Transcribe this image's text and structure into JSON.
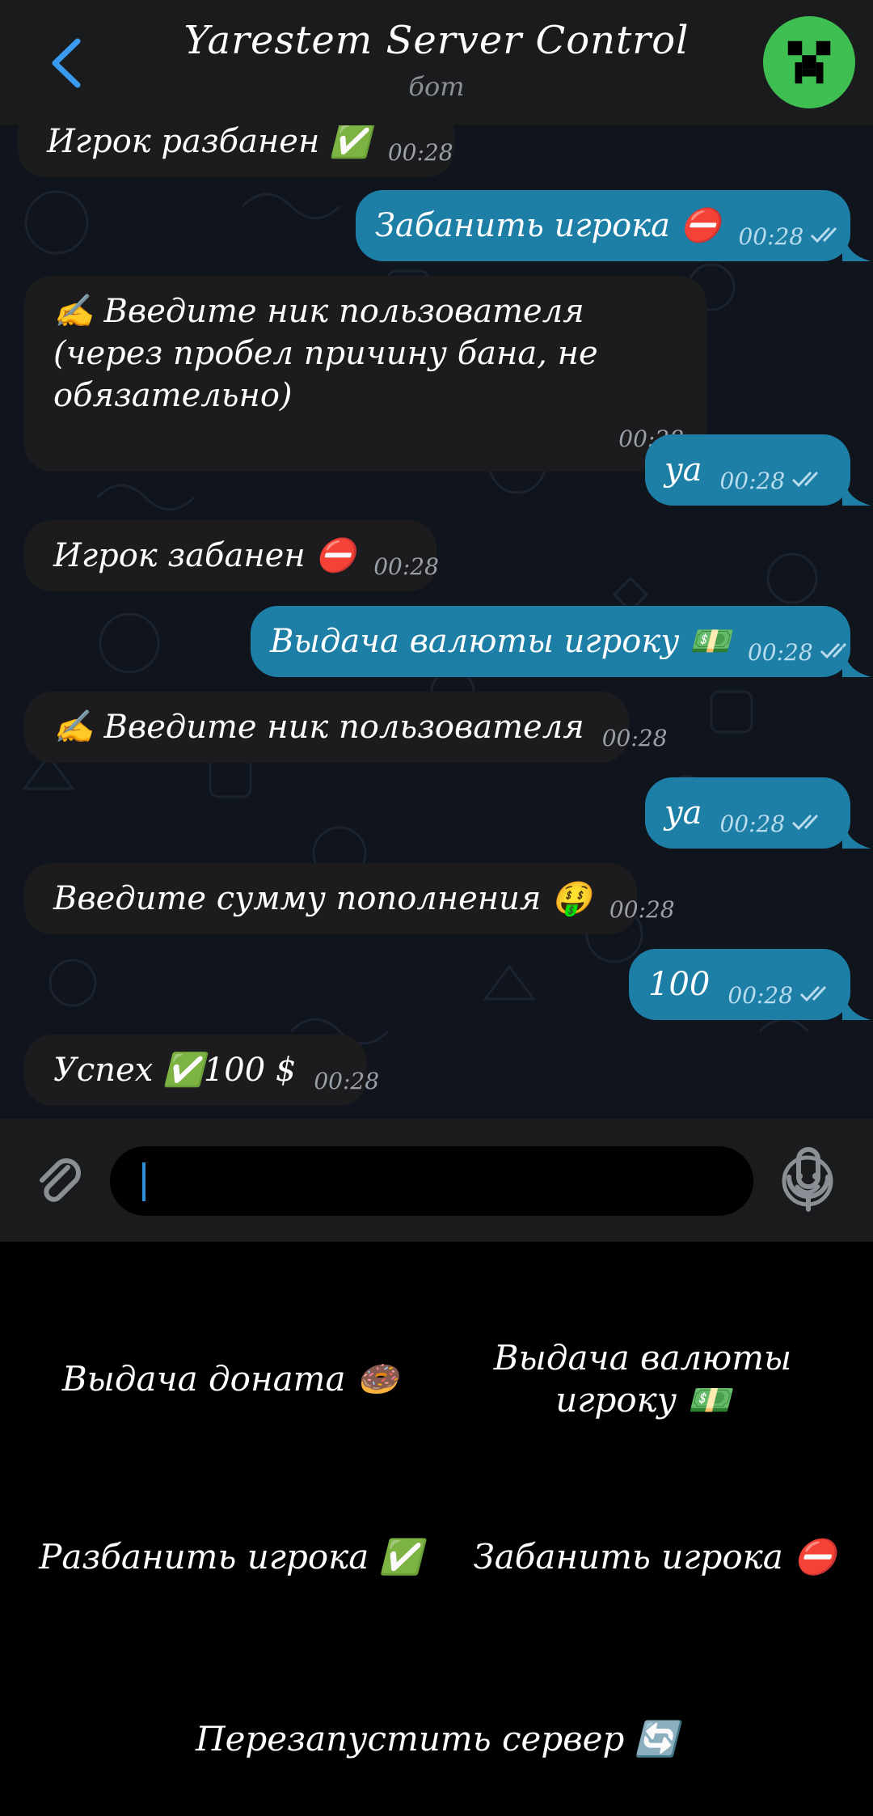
{
  "header": {
    "title": "Yarestem Server Control",
    "subtitle": "бот"
  },
  "messages": [
    {
      "dir": "in",
      "text": "Игрок разбанен ✅",
      "time": "00:28"
    },
    {
      "dir": "out",
      "text": "Забанить игрока ⛔",
      "time": "00:28"
    },
    {
      "dir": "in",
      "text": "✍️ Введите ник пользователя (через пробел причину бана, не обязательно)",
      "time": "00:28"
    },
    {
      "dir": "out",
      "text": "ya",
      "time": "00:28"
    },
    {
      "dir": "in",
      "text": "Игрок забанен ⛔",
      "time": "00:28"
    },
    {
      "dir": "out",
      "text": "Выдача валюты игроку 💵",
      "time": "00:28"
    },
    {
      "dir": "in",
      "text": "✍️ Введите ник пользователя",
      "time": "00:28"
    },
    {
      "dir": "out",
      "text": "ya",
      "time": "00:28"
    },
    {
      "dir": "in",
      "text": "Введите сумму пополнения 🤑",
      "time": "00:28"
    },
    {
      "dir": "out",
      "text": "100",
      "time": "00:28"
    },
    {
      "dir": "in",
      "text": "Успех ✅100 $",
      "time": "00:28"
    }
  ],
  "input": {
    "value": "",
    "icons": {
      "attach": "paperclip-icon",
      "emoji": "emoji-icon",
      "mic": "microphone-icon"
    }
  },
  "keyboard": {
    "buttons": [
      "Выдача доната 🍩",
      "Выдача валюты игроку 💵",
      "Разбанить игрока ✅",
      "Забанить игрока ⛔",
      "Перезапустить сервер 🔄"
    ]
  },
  "colors": {
    "header_bg": "#1a1b1d",
    "chat_bg": "#10141c",
    "incoming_bubble": "#1c1c1e",
    "outgoing_bubble": "#1d7ea6",
    "accent": "#2f8fd8",
    "avatar": "#3fbf52"
  }
}
